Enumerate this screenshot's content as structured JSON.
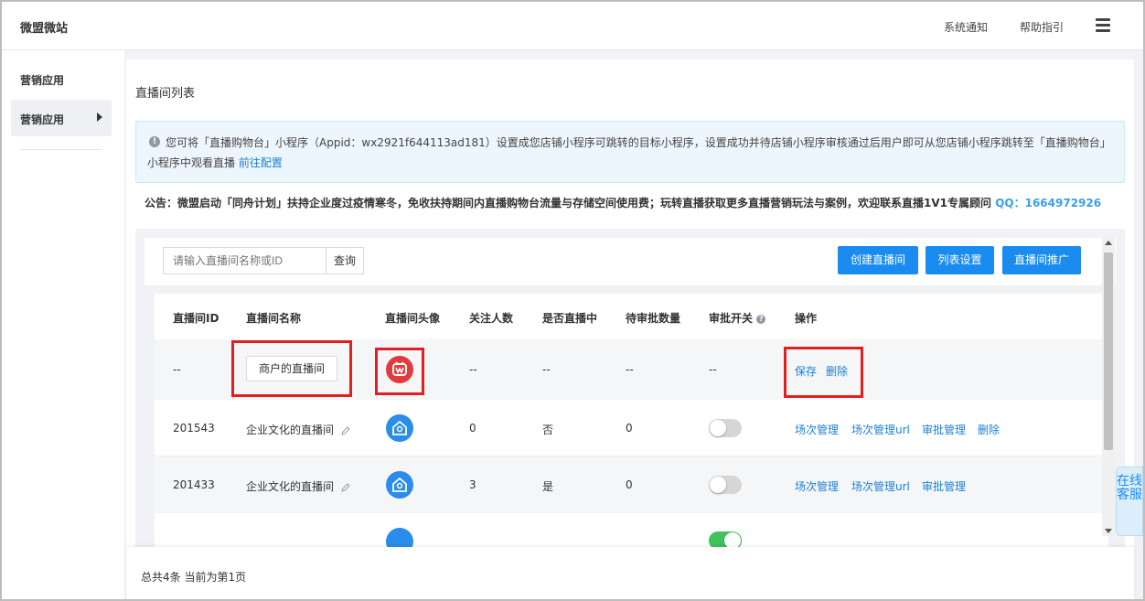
{
  "app": {
    "brand": "微盟微站"
  },
  "topnav": {
    "notifications": "系统通知",
    "help": "帮助指引"
  },
  "sidebar": {
    "heading": "营销应用",
    "active_item": "营销应用"
  },
  "page": {
    "title": "直播间列表",
    "notice_text": "您可将「直播购物台」小程序（Appid：wx2921f644113ad181）设置成您店铺小程序可跳转的目标小程序，设置成功并待店铺小程序审核通过后用户即可从您店铺小程序跳转至「直播购物台」小程序中观看直播",
    "notice_link": "前往配置",
    "announcement": "公告：微盟启动「同舟计划」扶持企业度过疫情寒冬，免收扶持期间内直播购物台流量与存储空间使用费；玩转直播获取更多直播营销玩法与案例，欢迎联系直播1V1专属顾问",
    "qq": "QQ：1664972926"
  },
  "toolbar": {
    "search_placeholder": "请输入直播间名称或ID",
    "search_label": "查询",
    "create_label": "创建直播间",
    "list_settings_label": "列表设置",
    "promote_label": "直播间推广"
  },
  "table": {
    "headers": [
      "直播间ID",
      "直播间名称",
      "直播间头像",
      "关注人数",
      "是否直播中",
      "待审批数量",
      "审批开关",
      "操作"
    ],
    "rows": [
      {
        "id": "--",
        "name": "商户的直播间",
        "followers": "--",
        "live": "--",
        "pending": "--",
        "switch": "--",
        "actions": [
          "保存",
          "删除"
        ]
      },
      {
        "id": "201543",
        "name": "企业文化的直播间",
        "followers": "0",
        "live": "否",
        "pending": "0",
        "switch_on": false,
        "actions": [
          "场次管理",
          "场次管理url",
          "审批管理",
          "删除"
        ]
      },
      {
        "id": "201433",
        "name": "企业文化的直播间",
        "followers": "3",
        "live": "是",
        "pending": "0",
        "switch_on": false,
        "actions": [
          "场次管理",
          "场次管理url",
          "审批管理"
        ]
      },
      {
        "switch_on": true
      }
    ]
  },
  "chat": {
    "label": "在线客服"
  },
  "footer": {
    "summary": "总共4条 当前为第1页"
  },
  "colors": {
    "primary": "#1a8cf0",
    "link": "#1a7fd9",
    "highlight": "#e02020",
    "toggle_on": "#3fc35a"
  }
}
